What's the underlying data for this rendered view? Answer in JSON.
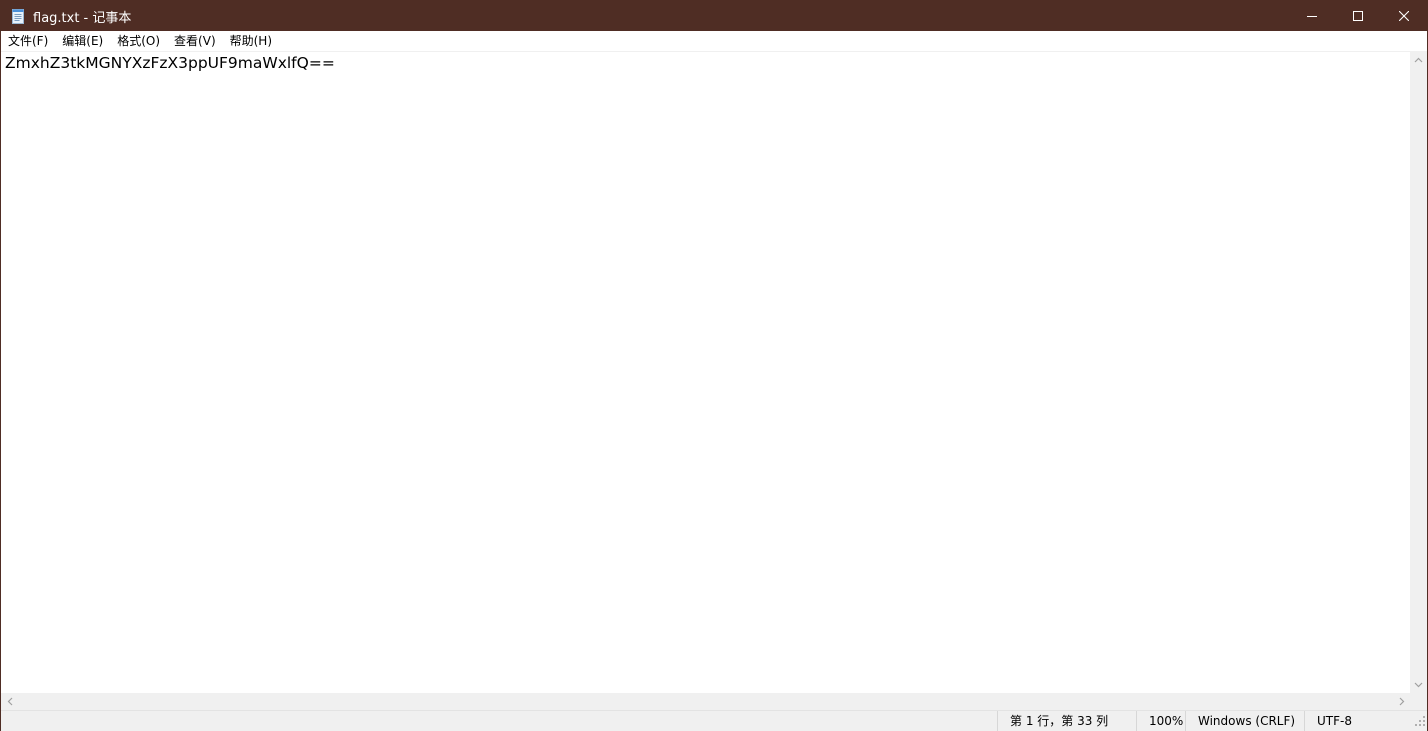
{
  "window": {
    "title": "flag.txt - 记事本",
    "titlebar_color": "#4f2d24"
  },
  "icons": {
    "app": "notepad-icon",
    "minimize": "minimize-icon",
    "maximize": "maximize-icon",
    "close": "close-icon"
  },
  "menu": {
    "items": [
      "文件(F)",
      "编辑(E)",
      "格式(O)",
      "查看(V)",
      "帮助(H)"
    ]
  },
  "editor": {
    "content": "ZmxhZ3tkMGNYXzFzX3ppUF9maWxlfQ=="
  },
  "status": {
    "position": "第 1 行，第 33 列",
    "zoom": "100%",
    "line_ending": "Windows (CRLF)",
    "encoding": "UTF-8"
  }
}
